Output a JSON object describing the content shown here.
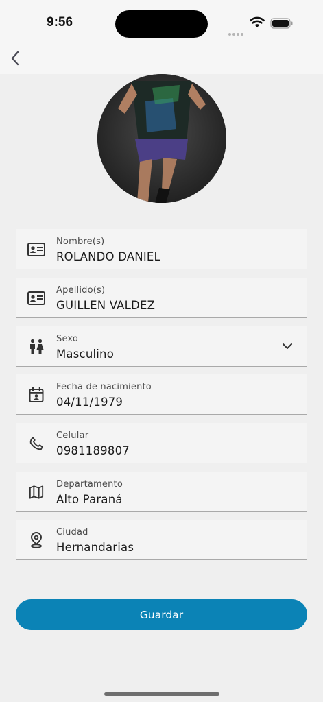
{
  "status_bar": {
    "time": "9:56"
  },
  "navigation": {
    "back_icon": "chevron-left-icon"
  },
  "profile": {
    "photo": "athlete-photo"
  },
  "fields": [
    {
      "id": "nombres",
      "label": "Nombre(s)",
      "value": "ROLANDO DANIEL",
      "icon": "id-card-icon"
    },
    {
      "id": "apellidos",
      "label": "Apellido(s)",
      "value": "GUILLEN VALDEZ",
      "icon": "id-card-icon"
    },
    {
      "id": "sexo",
      "label": "Sexo",
      "value": "Masculino",
      "icon": "people-icon",
      "dropdown": true
    },
    {
      "id": "fecha",
      "label": "Fecha de nacimiento",
      "value": "04/11/1979",
      "icon": "calendar-user-icon"
    },
    {
      "id": "celular",
      "label": "Celular",
      "value": "0981189807",
      "icon": "phone-icon"
    },
    {
      "id": "departamento",
      "label": "Departamento",
      "value": "Alto Paraná",
      "icon": "map-icon"
    },
    {
      "id": "ciudad",
      "label": "Ciudad",
      "value": "Hernandarias",
      "icon": "location-pin-icon"
    }
  ],
  "actions": {
    "save_label": "Guardar"
  },
  "colors": {
    "primary": "#0b83b6",
    "background": "#efefef",
    "field_background": "#f4f4f4"
  }
}
